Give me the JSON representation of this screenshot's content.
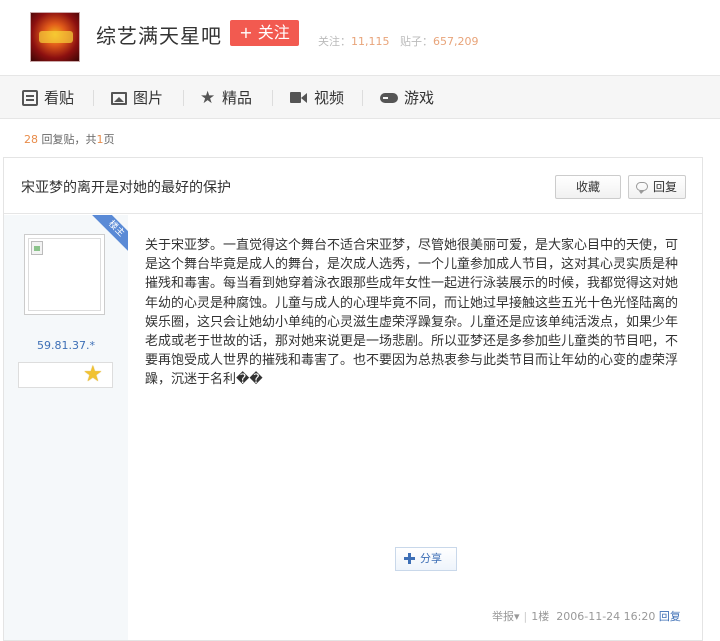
{
  "header": {
    "forum_name": "综艺满天星吧",
    "follow_label": "+ 关注",
    "follow_prefix": "关注：",
    "follow_count": "11,115",
    "post_prefix": "贴子：",
    "post_count": "657,209"
  },
  "nav": {
    "items": [
      {
        "label": "看贴",
        "icon": "document-icon"
      },
      {
        "label": "图片",
        "icon": "image-icon"
      },
      {
        "label": "精品",
        "icon": "star-icon"
      },
      {
        "label": "视频",
        "icon": "video-icon"
      },
      {
        "label": "游戏",
        "icon": "gamepad-icon"
      }
    ]
  },
  "thread": {
    "reply_count": "28",
    "reply_text": "回复贴，共",
    "page_count": "1",
    "page_suffix": "页",
    "title": "宋亚梦的离开是对她的最好的保护",
    "fav_label": "收藏",
    "reply_label": "回复"
  },
  "post": {
    "badge": "楼主",
    "user_ip": "59.81.37.*",
    "content": "关于宋亚梦。一直觉得这个舞台不适合宋亚梦，尽管她很美丽可爱，是大家心目中的天使，可是这个舞台毕竟是成人的舞台，是次成人选秀，一个儿童参加成人节目，这对其心灵实质是种摧残和毒害。每当看到她穿着泳衣跟那些成年女性一起进行泳装展示的时候，我都觉得这对她年幼的心灵是种腐蚀。儿童与成人的心理毕竟不同，而让她过早接触这些五光十色光怪陆离的娱乐圈，这只会让她幼小单纯的心灵滋生虚荣浮躁复杂。儿童还是应该单纯活泼点，如果少年老成或老于世故的话，那对她来说更是一场悲剧。所以亚梦还是多参加些儿童类的节目吧，不要再饱受成人世界的摧残和毒害了。也不要因为总热衷参与此类节目而让年幼的心变的虚荣浮躁，沉迷于名利��",
    "share_label": "分享",
    "report_label": "举报",
    "floor": "1楼",
    "timestamp": "2006-11-24 16:20",
    "reply_link": "回复"
  }
}
